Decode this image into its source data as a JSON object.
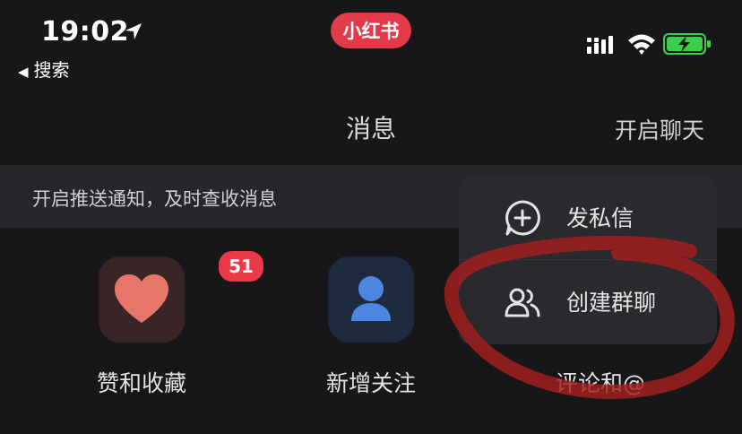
{
  "status_bar": {
    "time": "19:02",
    "back_label": "搜索",
    "app_badge": "小红书"
  },
  "nav": {
    "title": "消息",
    "action": "开启聊天"
  },
  "push_banner": {
    "text": "开启推送通知，及时查收消息"
  },
  "quick_actions": [
    {
      "label": "赞和收藏",
      "badge": "51",
      "icon": "heart-icon"
    },
    {
      "label": "新增关注",
      "icon": "person-icon"
    },
    {
      "label": "评论和@",
      "icon": "comment-icon"
    }
  ],
  "popup_menu": {
    "items": [
      {
        "label": "发私信",
        "icon": "add-message-icon"
      },
      {
        "label": "创建群聊",
        "icon": "group-icon"
      }
    ]
  },
  "colors": {
    "background": "#17171a",
    "brand_red": "#e33a4a",
    "heart": "#e8756a",
    "person_blue": "#4d86e0",
    "annotation_red": "#a51e1e",
    "battery_green": "#3ecf4a"
  }
}
